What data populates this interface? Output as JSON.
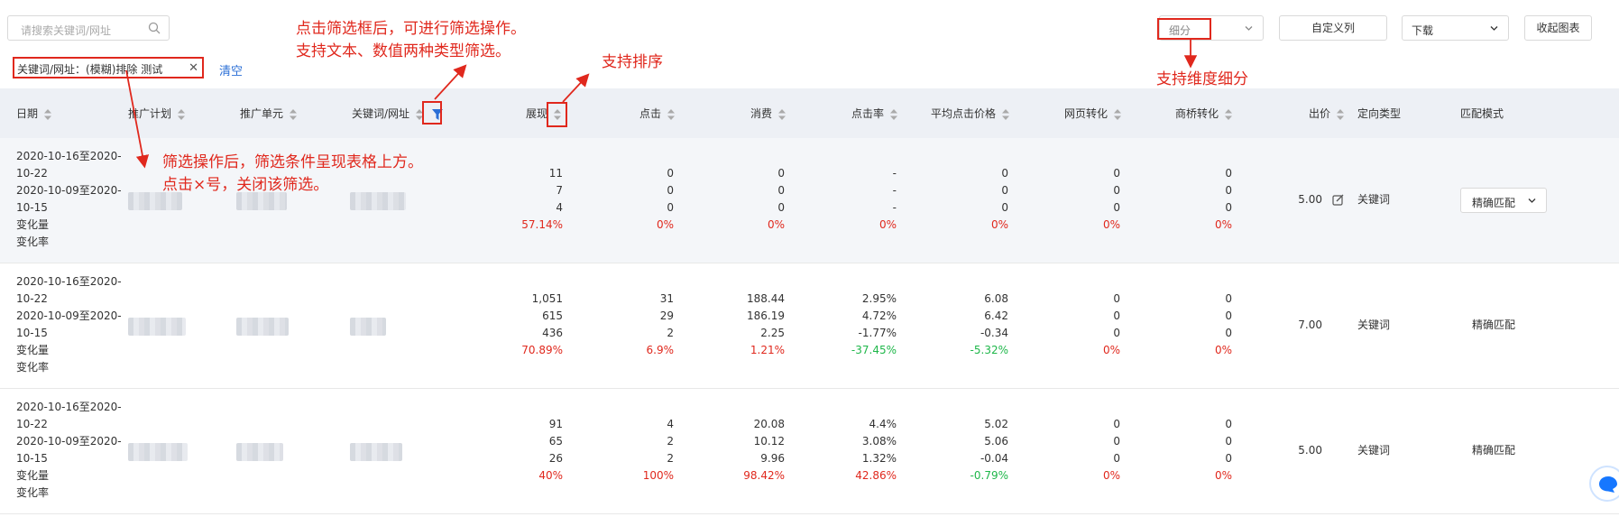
{
  "toolbar": {
    "search_placeholder": "请搜索关键词/网址",
    "segment_value": "细分",
    "custom_columns": "自定义列",
    "download": "下载",
    "collapse_chart": "收起图表"
  },
  "filter": {
    "tag_text": "关键词/网址：(模糊)排除 测试",
    "clear_label": "清空"
  },
  "columns": [
    "日期",
    "推广计划",
    "推广单元",
    "关键词/网址",
    "展现",
    "点击",
    "消费",
    "点击率",
    "平均点击价格",
    "网页转化",
    "商桥转化",
    "出价",
    "定向类型",
    "匹配模式"
  ],
  "rows": [
    {
      "date_lines": [
        "2020-10-16至2020-",
        "10-22",
        "2020-10-09至2020-",
        "10-15",
        "变化量",
        "变化率"
      ],
      "impressions": [
        "11",
        "7",
        "4",
        "57.14%"
      ],
      "clicks": [
        "0",
        "0",
        "0",
        "0%"
      ],
      "cost": [
        "0",
        "0",
        "0",
        "0%"
      ],
      "ctr": [
        "-",
        "-",
        "-",
        "0%"
      ],
      "avg_cpc": [
        "0",
        "0",
        "0",
        "0%"
      ],
      "web_conv": [
        "0",
        "0",
        "0",
        "0%"
      ],
      "bridge_conv": [
        "0",
        "0",
        "0",
        "0%"
      ],
      "bid": "5.00",
      "target_type": "关键词",
      "match_mode": "精确匹配"
    },
    {
      "date_lines": [
        "2020-10-16至2020-",
        "10-22",
        "2020-10-09至2020-",
        "10-15",
        "变化量",
        "变化率"
      ],
      "impressions": [
        "1,051",
        "615",
        "436",
        "70.89%"
      ],
      "clicks": [
        "31",
        "29",
        "2",
        "6.9%"
      ],
      "cost": [
        "188.44",
        "186.19",
        "2.25",
        "1.21%"
      ],
      "ctr": [
        "2.95%",
        "4.72%",
        "-1.77%",
        "-37.45%"
      ],
      "avg_cpc": [
        "6.08",
        "6.42",
        "-0.34",
        "-5.32%"
      ],
      "web_conv": [
        "0",
        "0",
        "0",
        "0%"
      ],
      "bridge_conv": [
        "0",
        "0",
        "0",
        "0%"
      ],
      "bid": "7.00",
      "target_type": "关键词",
      "match_mode": "精确匹配"
    },
    {
      "date_lines": [
        "2020-10-16至2020-",
        "10-22",
        "2020-10-09至2020-",
        "10-15",
        "变化量",
        "变化率"
      ],
      "impressions": [
        "91",
        "65",
        "26",
        "40%"
      ],
      "clicks": [
        "4",
        "2",
        "2",
        "100%"
      ],
      "cost": [
        "20.08",
        "10.12",
        "9.96",
        "98.42%"
      ],
      "ctr": [
        "4.4%",
        "3.08%",
        "1.32%",
        "42.86%"
      ],
      "avg_cpc": [
        "5.02",
        "5.06",
        "-0.04",
        "-0.79%"
      ],
      "web_conv": [
        "0",
        "0",
        "0",
        "0%"
      ],
      "bridge_conv": [
        "0",
        "0",
        "0",
        "0%"
      ],
      "bid": "5.00",
      "target_type": "关键词",
      "match_mode": "精确匹配"
    }
  ],
  "annotations": {
    "filter_note_1": "点击筛选框后，可进行筛选操作。",
    "filter_note_2": "支持文本、数值两种类型筛选。",
    "sort_note": "支持排序",
    "segment_note": "支持维度细分",
    "result_note_1": "筛选操作后，筛选条件呈现表格上方。",
    "result_note_2": "点击×号，关闭该筛选。"
  },
  "colors": {
    "annotation": "#e0281d",
    "link": "#2b6fd6",
    "negative": "#1fb74a",
    "positive": "#e0281d",
    "header_bg": "#edf0f5"
  }
}
